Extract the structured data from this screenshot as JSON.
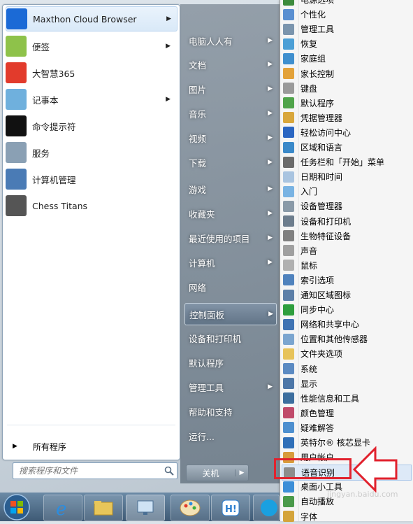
{
  "start_menu": {
    "pinned_programs": [
      {
        "label": "Maxthon Cloud Browser",
        "has_submenu": true,
        "icon": "maxthon-icon",
        "color": "#1b6ad6"
      },
      {
        "label": "便签",
        "has_submenu": true,
        "icon": "sticky-notes-icon",
        "color": "#8ec24a"
      },
      {
        "label": "大智慧365",
        "has_submenu": false,
        "icon": "dazhihui-icon",
        "color": "#e23b2c"
      },
      {
        "label": "记事本",
        "has_submenu": true,
        "icon": "notepad-icon",
        "color": "#6fb0dd"
      },
      {
        "label": "命令提示符",
        "has_submenu": false,
        "icon": "cmd-icon",
        "color": "#111111"
      },
      {
        "label": "服务",
        "has_submenu": false,
        "icon": "services-gear-icon",
        "color": "#8aa0b4"
      },
      {
        "label": "计算机管理",
        "has_submenu": false,
        "icon": "computer-management-icon",
        "color": "#4a7bb5"
      },
      {
        "label": "Chess Titans",
        "has_submenu": false,
        "icon": "chess-icon",
        "color": "#555555"
      }
    ],
    "all_programs_label": "所有程序",
    "search_placeholder": "搜索程序和文件",
    "right_items": [
      {
        "label": "电脑人人有",
        "has_submenu": true
      },
      {
        "label": "文档",
        "has_submenu": true
      },
      {
        "label": "图片",
        "has_submenu": true
      },
      {
        "label": "音乐",
        "has_submenu": true
      },
      {
        "label": "视频",
        "has_submenu": true
      },
      {
        "label": "下载",
        "has_submenu": true
      },
      {
        "label": "游戏",
        "has_submenu": true
      },
      {
        "label": "收藏夹",
        "has_submenu": true
      },
      {
        "label": "最近使用的项目",
        "has_submenu": true
      },
      {
        "label": "计算机",
        "has_submenu": true
      },
      {
        "label": "网络",
        "has_submenu": false
      },
      {
        "label": "控制面板",
        "has_submenu": true,
        "active": true
      },
      {
        "label": "设备和打印机",
        "has_submenu": false
      },
      {
        "label": "默认程序",
        "has_submenu": false
      },
      {
        "label": "管理工具",
        "has_submenu": true
      },
      {
        "label": "帮助和支持",
        "has_submenu": false
      },
      {
        "label": "运行...",
        "has_submenu": false
      }
    ],
    "shutdown_label": "关机"
  },
  "control_panel_menu": {
    "items": [
      {
        "label": "电源选项",
        "color": "#3c8b3c"
      },
      {
        "label": "个性化",
        "color": "#5a8fd1"
      },
      {
        "label": "管理工具",
        "color": "#7a94ad"
      },
      {
        "label": "恢复",
        "color": "#4c9fd6"
      },
      {
        "label": "家庭组",
        "color": "#3f8fce"
      },
      {
        "label": "家长控制",
        "color": "#e3a23a"
      },
      {
        "label": "键盘",
        "color": "#9a9a9a"
      },
      {
        "label": "默认程序",
        "color": "#4fa44a"
      },
      {
        "label": "凭据管理器",
        "color": "#d9a73c"
      },
      {
        "label": "轻松访问中心",
        "color": "#2a66c2"
      },
      {
        "label": "区域和语言",
        "color": "#3a89c9"
      },
      {
        "label": "任务栏和「开始」菜单",
        "color": "#6b6b6b"
      },
      {
        "label": "日期和时间",
        "color": "#a9c4e0"
      },
      {
        "label": "入门",
        "color": "#79b3e3"
      },
      {
        "label": "设备管理器",
        "color": "#8a9aa8"
      },
      {
        "label": "设备和打印机",
        "color": "#6d7d8d"
      },
      {
        "label": "生物特征设备",
        "color": "#808080"
      },
      {
        "label": "声音",
        "color": "#a0a0a0"
      },
      {
        "label": "鼠标",
        "color": "#b0b0b0"
      },
      {
        "label": "索引选项",
        "color": "#4f82bd"
      },
      {
        "label": "通知区域图标",
        "color": "#5c7fa8"
      },
      {
        "label": "同步中心",
        "color": "#2e9e3e"
      },
      {
        "label": "网络和共享中心",
        "color": "#3f73b3"
      },
      {
        "label": "位置和其他传感器",
        "color": "#7ba5cf"
      },
      {
        "label": "文件夹选项",
        "color": "#e7c35a"
      },
      {
        "label": "系统",
        "color": "#5b8ac2"
      },
      {
        "label": "显示",
        "color": "#4d77a8"
      },
      {
        "label": "性能信息和工具",
        "color": "#3c6e9e"
      },
      {
        "label": "颜色管理",
        "color": "#c04a6a"
      },
      {
        "label": "疑难解答",
        "color": "#4d8fcf"
      },
      {
        "label": "英特尔® 核芯显卡",
        "color": "#2f6fb8"
      },
      {
        "label": "用户帐户",
        "color": "#d79b3b"
      },
      {
        "label": "语音识别",
        "color": "#8c8c8c",
        "highlighted": true
      },
      {
        "label": "桌面小工具",
        "color": "#3d8fd8"
      },
      {
        "label": "自动播放",
        "color": "#4a9a4a"
      },
      {
        "label": "字体",
        "color": "#d4a43a"
      }
    ]
  },
  "taskbar": {
    "buttons": [
      "start-orb",
      "ie-icon",
      "explorer-folder-icon",
      "remote-desktop-icon",
      "paint-icon",
      "hi-app-icon"
    ]
  },
  "watermark": "jingyan.baidu.com",
  "annotation": {
    "highlight_color": "#e1212d"
  }
}
